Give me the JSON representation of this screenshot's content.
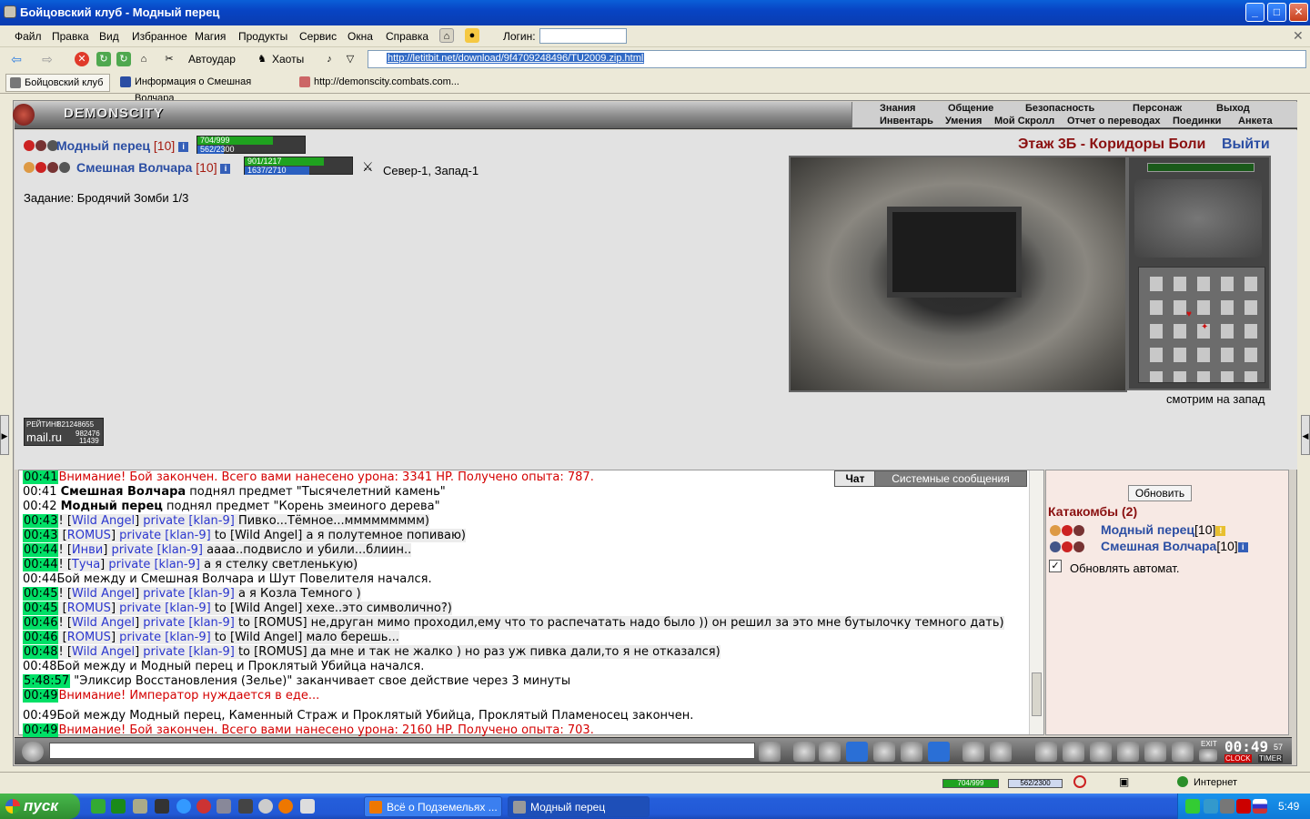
{
  "window": {
    "title": "Бойцовский клуб - Модный перец"
  },
  "menu": [
    "Файл",
    "Правка",
    "Вид",
    "Избранное",
    "Магия",
    "Продукты",
    "Сервис",
    "Окна",
    "Справка"
  ],
  "login_label": "Логин:",
  "toolbar": {
    "autostrike": "Автоудар",
    "chaots": "Хаоты"
  },
  "address": "http://letitbit.net/download/9f4709248496/TU2009.zip.html",
  "tabs": [
    "Бойцовский клуб",
    "Информация о Смешная Волчара",
    "http://demonscity.combats.com..."
  ],
  "game": {
    "logo": "DEMONSCITY",
    "nav_top": [
      "Знания",
      "Общение",
      "Безопасность",
      "Персонаж",
      "Выход"
    ],
    "nav_bottom": [
      "Инвентарь",
      "Умения",
      "Мой Скролл",
      "Отчет о переводах",
      "Поединки",
      "Анкета"
    ],
    "player1": {
      "name": "Модный перец",
      "level": "[10]",
      "hp": "704/999",
      "mp": "562/2300",
      "hp_frac": 0.705,
      "mp_frac": 0.244
    },
    "player2": {
      "name": "Смешная Волчара",
      "level": "[10]",
      "hp": "901/1217",
      "mp": "1637/2710",
      "hp_frac": 0.74,
      "mp_frac": 0.604
    },
    "coords": "Север-1, Запад-1",
    "quest": "Задание: Бродячий Зомби 1/3",
    "location": "Этаж 3Б - Коридоры Боли",
    "exit": "Выйти",
    "facing": "смотрим на запад",
    "rating_label": "РЕЙТИНГ",
    "rating_values": [
      "821248655",
      "982476",
      "11439"
    ],
    "rating_site": "mail.ru"
  },
  "chat": {
    "tabs": [
      "Чат",
      "Системные сообщения"
    ],
    "messages": [
      {
        "time": "00:41",
        "text": "Внимание! Бой закончен. Всего вами нанесено урона: 3341 HP. Получено опыта: 787."
      },
      {
        "time": "00:41",
        "bold": "Смешная Волчара",
        "text": " поднял предмет \"Тысячелетний камень\""
      },
      {
        "time": "00:42",
        "bold": "Модный перец",
        "text": " поднял предмет \"Корень змеиного дерева\""
      },
      {
        "time": "00:43",
        "prefix": "! [",
        "user": "Wild Angel",
        "mid": "] ",
        "priv": "private [klan-9]",
        "text": " Пивко...Тёмное...ммммммммм)"
      },
      {
        "time": "00:43",
        "prefix": " [",
        "user": "ROMUS",
        "mid": "] ",
        "priv": "private [klan-9]",
        "text": " to [Wild Angel] а я полутемное попиваю)"
      },
      {
        "time": "00:44",
        "prefix": "! [",
        "user": "Инви",
        "mid": "] ",
        "priv": "private [klan-9]",
        "text": " аааа..подвисло и убили...блиин.."
      },
      {
        "time": "00:44",
        "prefix": "! [",
        "user": "Туча",
        "mid": "] ",
        "priv": "private [klan-9]",
        "text": " а я стелку светленькую)"
      },
      {
        "time": "00:44",
        "text": "Бой между и Смешная Волчара и Шут Повелителя начался."
      },
      {
        "time": "00:45",
        "prefix": "! [",
        "user": "Wild Angel",
        "mid": "] ",
        "priv": "private [klan-9]",
        "text": " а я Козла Темного )"
      },
      {
        "time": "00:45",
        "prefix": " [",
        "user": "ROMUS",
        "mid": "] ",
        "priv": "private [klan-9]",
        "text": " to [Wild Angel] хехе..это символично?)"
      },
      {
        "time": "00:46",
        "prefix": "! [",
        "user": "Wild Angel",
        "mid": "] ",
        "priv": "private [klan-9]",
        "text": " to [ROMUS] не,друган мимо проходил,ему что то распечатать надо было )) он решил за это мне бутылочку темного дать)"
      },
      {
        "time": "00:46",
        "prefix": " [",
        "user": "ROMUS",
        "mid": "] ",
        "priv": "private [klan-9]",
        "text": " to [Wild Angel] мало берешь..."
      },
      {
        "time": "00:48",
        "prefix": "! [",
        "user": "Wild Angel",
        "mid": "] ",
        "priv": "private [klan-9]",
        "text": " to [ROMUS] да мне и так не жалко ) но раз уж пивка дали,то я не отказался)"
      },
      {
        "time": "00:48",
        "text": "Бой между и Модный перец и Проклятый Убийца начался."
      },
      {
        "time": "5:48:57",
        "text": " \"Эликсир Восстановления (Зелье)\" заканчивает свое действие через 3 минуты"
      },
      {
        "time": "00:49",
        "text": "Внимание! Император нуждается в еде..."
      },
      {
        "time": "00:49",
        "text": "Бой между Модный перец, Каменный Страж и Проклятый Убийца, Проклятый Пламеносец закончен."
      },
      {
        "time": "00:49",
        "text": "Внимание! Бой закончен. Всего вами нанесено урона: 2160 HP. Получено опыта: 703."
      }
    ]
  },
  "online": {
    "refresh": "Обновить",
    "room": "Катакомбы (2)",
    "users": [
      {
        "name": "Модный перец",
        "level": "[10]"
      },
      {
        "name": "Смешная Волчара",
        "level": "[10]"
      }
    ],
    "auto_refresh": "Обновлять автомат."
  },
  "clock": {
    "time": "00:49",
    "seconds": "57",
    "clock_label": "CLOCK",
    "timer_label": "TIMER",
    "exit_label": "EXIT"
  },
  "status": {
    "hp": "704/999",
    "mp": "562/2300",
    "zone": "Интернет"
  },
  "taskbar": {
    "start": "пуск",
    "tasks": [
      "Всё о Подземельях ...",
      "Модный перец"
    ],
    "time": "5:49"
  }
}
